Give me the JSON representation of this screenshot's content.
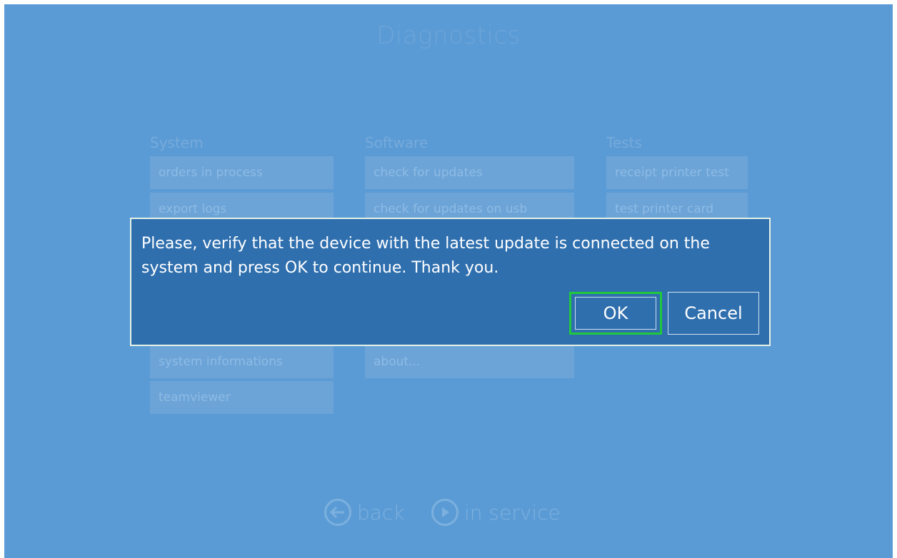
{
  "screen": {
    "title": "Diagnostics"
  },
  "columns": {
    "system": {
      "header": "System",
      "items": [
        "orders in process",
        "export logs",
        "system informations",
        "teamviewer"
      ]
    },
    "software": {
      "header": "Software",
      "items": [
        "check for updates",
        "check for updates on usb",
        "about..."
      ]
    },
    "tests": {
      "header": "Tests",
      "items": [
        "receipt printer test",
        "test printer card"
      ]
    }
  },
  "dialog": {
    "message": "Please, verify that the device with the latest update is connected on the system and press OK to continue. Thank you.",
    "ok_label": "OK",
    "cancel_label": "Cancel"
  },
  "nav": {
    "back_label": "back",
    "in_service_label": "in service"
  }
}
